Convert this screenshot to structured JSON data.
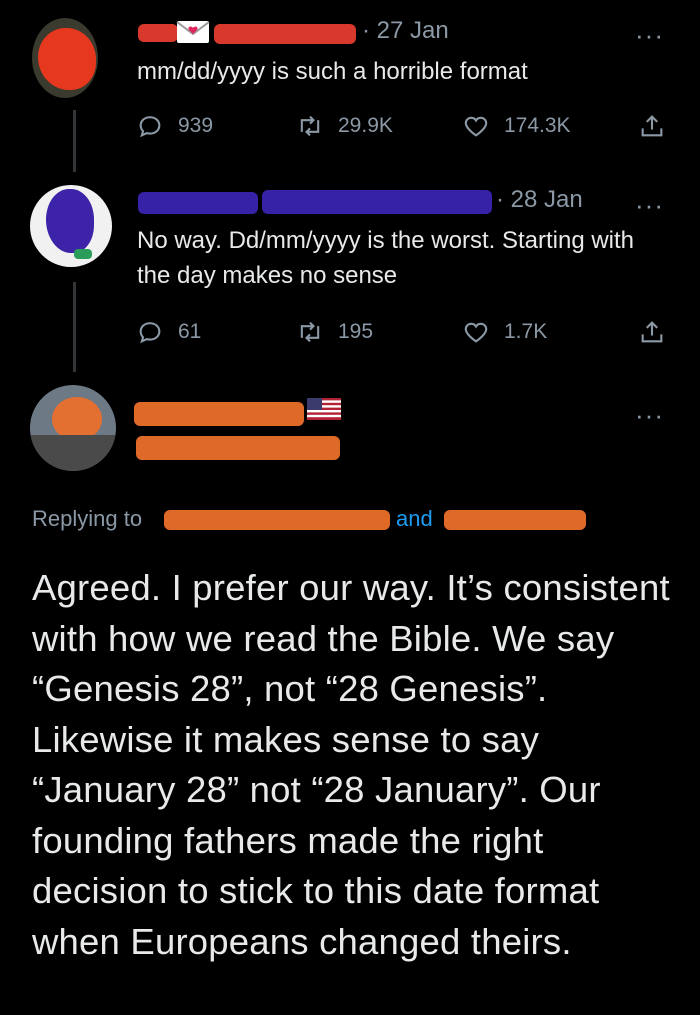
{
  "tweets": [
    {
      "date": "· 27 Jan",
      "text": "mm/dd/yyyy is such a horrible format",
      "replies": "939",
      "retweets": "29.9K",
      "likes": "174.3K"
    },
    {
      "date": "· 28 Jan",
      "text": "No way. Dd/mm/yyyy is the worst. Starting with the day makes no sense",
      "replies": "61",
      "retweets": "195",
      "likes": "1.7K"
    },
    {
      "replying_label": "Replying to",
      "replying_and": "and",
      "text": "Agreed. I prefer our way. It’s consistent with how we read the Bible. We say “Genesis 28”, not “28 Genesis”. Likewise it makes sense to say “January 28” not “28 January”. Our founding fathers made the right decision to stick to this date format when Europeans changed theirs."
    }
  ],
  "more_icon": "···",
  "icons": [
    "reply-icon",
    "retweet-icon",
    "like-icon",
    "share-icon",
    "more-icon",
    "flag-icon",
    "envelope-icon"
  ],
  "colors": {
    "background": "#000000",
    "text": "#e7e9ea",
    "muted": "#8b98a5",
    "link": "#1d9bf0"
  }
}
